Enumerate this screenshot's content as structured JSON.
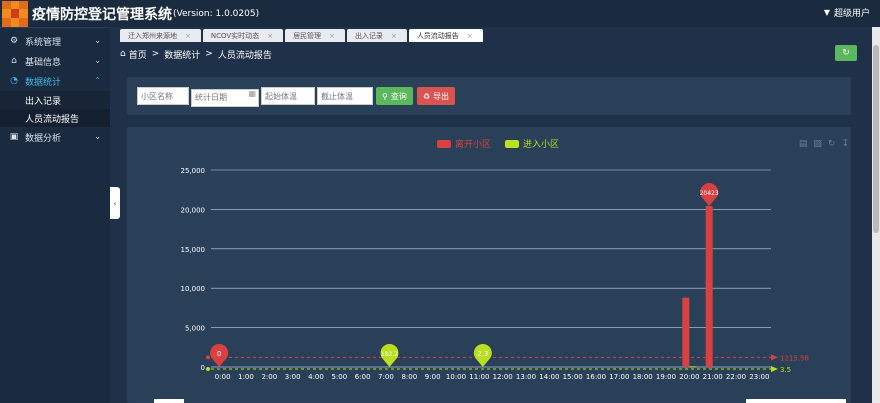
{
  "header": {
    "title": "疫情防控登记管理系统",
    "version": "(Version: 1.0.0205)",
    "user": "超级用户"
  },
  "sidebar": {
    "items": [
      {
        "label": "系统管理",
        "icon": "gear-icon"
      },
      {
        "label": "基础信息",
        "icon": "home-icon"
      },
      {
        "label": "数据统计",
        "icon": "pie-icon"
      },
      {
        "label": "数据分析",
        "icon": "chart-icon"
      }
    ],
    "sub_items": [
      {
        "label": "出入记录"
      },
      {
        "label": "人员流动报告"
      }
    ]
  },
  "tabs": [
    {
      "label": "迁入郑州来源地"
    },
    {
      "label": "NCOV实时动态"
    },
    {
      "label": "居民管理"
    },
    {
      "label": "出入记录"
    },
    {
      "label": "人员流动报告"
    }
  ],
  "breadcrumb": {
    "home": "首页",
    "level1": "数据统计",
    "level2": "人员流动报告"
  },
  "filters": {
    "community_placeholder": "小区名称",
    "date_placeholder": "统计日期",
    "min_temp_placeholder": "起始体温",
    "max_temp_placeholder": "截止体温",
    "query_label": "查询",
    "export_label": "导出"
  },
  "colors": {
    "leave": "#d94040",
    "enter": "#b8e01f"
  },
  "chart_data": {
    "type": "bar",
    "legend": [
      "离开小区",
      "进入小区"
    ],
    "legend_position": "top-center",
    "categories": [
      "0:00",
      "1:00",
      "2:00",
      "3:00",
      "4:00",
      "5:00",
      "6:00",
      "7:00",
      "8:00",
      "9:00",
      "10:00",
      "11:00",
      "12:00",
      "13:00",
      "14:00",
      "15:00",
      "16:00",
      "17:00",
      "18:00",
      "19:00",
      "20:00",
      "21:00",
      "22:00",
      "23:00"
    ],
    "series": [
      {
        "name": "离开小区",
        "values": [
          0,
          0,
          0,
          0,
          0,
          0,
          0,
          0,
          0,
          0,
          0,
          0,
          0,
          0,
          0,
          0,
          0,
          0,
          0,
          0,
          8800,
          20423,
          0,
          0
        ],
        "note": "20:00 value is an estimate read off the axis; not printed in the screenshot",
        "max_label": "20423",
        "min_label": "0",
        "avg_label": "1215.58",
        "avg_value": 1215.58
      },
      {
        "name": "进入小区",
        "values": [
          0,
          0,
          0,
          0,
          0,
          0,
          0,
          0,
          0,
          0,
          0,
          0,
          0,
          0,
          0,
          0,
          0,
          0,
          0,
          0,
          84,
          0,
          0,
          0
        ],
        "max_label": "84",
        "min_label": "0",
        "avg_label": "3.5",
        "avg_value": 3.5
      },
      {
        "name": "进入小区-pins",
        "values": [
          0,
          0,
          0,
          0,
          0,
          0,
          0,
          182.2,
          0,
          0,
          0,
          2.3,
          0,
          0,
          0,
          0,
          0,
          0,
          0,
          0,
          0,
          0,
          0,
          0
        ]
      }
    ],
    "pins": [
      {
        "category": "0:00",
        "label": "0",
        "series": "离开小区"
      },
      {
        "category": "7:00",
        "label": "182.2",
        "series": "进入小区"
      },
      {
        "category": "11:00",
        "label": "2.3",
        "series": "进入小区"
      },
      {
        "category": "21:00",
        "label": "20423",
        "series": "离开小区"
      }
    ],
    "y_ticks": [
      "0",
      "5,000",
      "10,000",
      "15,000",
      "20,000",
      "25,000"
    ],
    "ylim": [
      0,
      25000
    ],
    "grid": true
  }
}
